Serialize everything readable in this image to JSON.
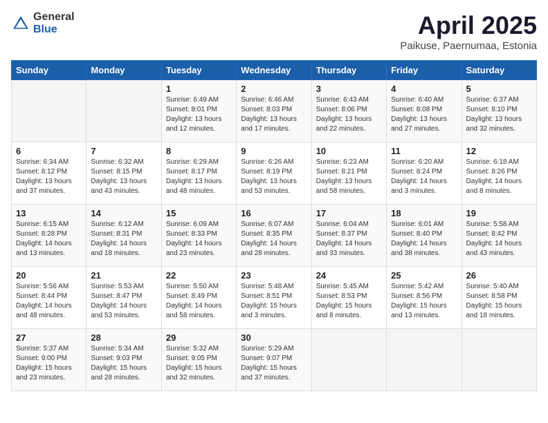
{
  "header": {
    "logo_general": "General",
    "logo_blue": "Blue",
    "month_title": "April 2025",
    "subtitle": "Paikuse, Paernumaa, Estonia"
  },
  "weekdays": [
    "Sunday",
    "Monday",
    "Tuesday",
    "Wednesday",
    "Thursday",
    "Friday",
    "Saturday"
  ],
  "weeks": [
    [
      {
        "day": "",
        "info": ""
      },
      {
        "day": "",
        "info": ""
      },
      {
        "day": "1",
        "info": "Sunrise: 6:49 AM\nSunset: 8:01 PM\nDaylight: 13 hours and 12 minutes."
      },
      {
        "day": "2",
        "info": "Sunrise: 6:46 AM\nSunset: 8:03 PM\nDaylight: 13 hours and 17 minutes."
      },
      {
        "day": "3",
        "info": "Sunrise: 6:43 AM\nSunset: 8:06 PM\nDaylight: 13 hours and 22 minutes."
      },
      {
        "day": "4",
        "info": "Sunrise: 6:40 AM\nSunset: 8:08 PM\nDaylight: 13 hours and 27 minutes."
      },
      {
        "day": "5",
        "info": "Sunrise: 6:37 AM\nSunset: 8:10 PM\nDaylight: 13 hours and 32 minutes."
      }
    ],
    [
      {
        "day": "6",
        "info": "Sunrise: 6:34 AM\nSunset: 8:12 PM\nDaylight: 13 hours and 37 minutes."
      },
      {
        "day": "7",
        "info": "Sunrise: 6:32 AM\nSunset: 8:15 PM\nDaylight: 13 hours and 43 minutes."
      },
      {
        "day": "8",
        "info": "Sunrise: 6:29 AM\nSunset: 8:17 PM\nDaylight: 13 hours and 48 minutes."
      },
      {
        "day": "9",
        "info": "Sunrise: 6:26 AM\nSunset: 8:19 PM\nDaylight: 13 hours and 53 minutes."
      },
      {
        "day": "10",
        "info": "Sunrise: 6:23 AM\nSunset: 8:21 PM\nDaylight: 13 hours and 58 minutes."
      },
      {
        "day": "11",
        "info": "Sunrise: 6:20 AM\nSunset: 8:24 PM\nDaylight: 14 hours and 3 minutes."
      },
      {
        "day": "12",
        "info": "Sunrise: 6:18 AM\nSunset: 8:26 PM\nDaylight: 14 hours and 8 minutes."
      }
    ],
    [
      {
        "day": "13",
        "info": "Sunrise: 6:15 AM\nSunset: 8:28 PM\nDaylight: 14 hours and 13 minutes."
      },
      {
        "day": "14",
        "info": "Sunrise: 6:12 AM\nSunset: 8:31 PM\nDaylight: 14 hours and 18 minutes."
      },
      {
        "day": "15",
        "info": "Sunrise: 6:09 AM\nSunset: 8:33 PM\nDaylight: 14 hours and 23 minutes."
      },
      {
        "day": "16",
        "info": "Sunrise: 6:07 AM\nSunset: 8:35 PM\nDaylight: 14 hours and 28 minutes."
      },
      {
        "day": "17",
        "info": "Sunrise: 6:04 AM\nSunset: 8:37 PM\nDaylight: 14 hours and 33 minutes."
      },
      {
        "day": "18",
        "info": "Sunrise: 6:01 AM\nSunset: 8:40 PM\nDaylight: 14 hours and 38 minutes."
      },
      {
        "day": "19",
        "info": "Sunrise: 5:58 AM\nSunset: 8:42 PM\nDaylight: 14 hours and 43 minutes."
      }
    ],
    [
      {
        "day": "20",
        "info": "Sunrise: 5:56 AM\nSunset: 8:44 PM\nDaylight: 14 hours and 48 minutes."
      },
      {
        "day": "21",
        "info": "Sunrise: 5:53 AM\nSunset: 8:47 PM\nDaylight: 14 hours and 53 minutes."
      },
      {
        "day": "22",
        "info": "Sunrise: 5:50 AM\nSunset: 8:49 PM\nDaylight: 14 hours and 58 minutes."
      },
      {
        "day": "23",
        "info": "Sunrise: 5:48 AM\nSunset: 8:51 PM\nDaylight: 15 hours and 3 minutes."
      },
      {
        "day": "24",
        "info": "Sunrise: 5:45 AM\nSunset: 8:53 PM\nDaylight: 15 hours and 8 minutes."
      },
      {
        "day": "25",
        "info": "Sunrise: 5:42 AM\nSunset: 8:56 PM\nDaylight: 15 hours and 13 minutes."
      },
      {
        "day": "26",
        "info": "Sunrise: 5:40 AM\nSunset: 8:58 PM\nDaylight: 15 hours and 18 minutes."
      }
    ],
    [
      {
        "day": "27",
        "info": "Sunrise: 5:37 AM\nSunset: 9:00 PM\nDaylight: 15 hours and 23 minutes."
      },
      {
        "day": "28",
        "info": "Sunrise: 5:34 AM\nSunset: 9:03 PM\nDaylight: 15 hours and 28 minutes."
      },
      {
        "day": "29",
        "info": "Sunrise: 5:32 AM\nSunset: 9:05 PM\nDaylight: 15 hours and 32 minutes."
      },
      {
        "day": "30",
        "info": "Sunrise: 5:29 AM\nSunset: 9:07 PM\nDaylight: 15 hours and 37 minutes."
      },
      {
        "day": "",
        "info": ""
      },
      {
        "day": "",
        "info": ""
      },
      {
        "day": "",
        "info": ""
      }
    ]
  ]
}
